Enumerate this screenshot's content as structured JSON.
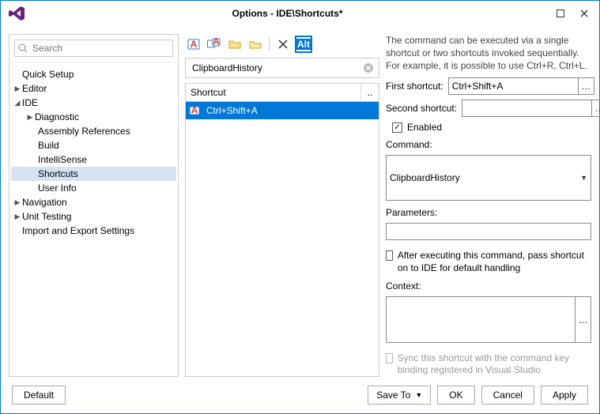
{
  "window": {
    "title": "Options - IDE\\Shortcuts*"
  },
  "search": {
    "placeholder": "Search"
  },
  "tree": {
    "quick_setup": "Quick Setup",
    "editor": "Editor",
    "ide": "IDE",
    "diagnostic": "Diagnostic",
    "assembly_refs": "Assembly References",
    "build": "Build",
    "intellisense": "IntelliSense",
    "shortcuts": "Shortcuts",
    "user_info": "User Info",
    "navigation": "Navigation",
    "unit_testing": "Unit Testing",
    "import_export": "Import and Export Settings"
  },
  "filter": {
    "value": "ClipboardHistory"
  },
  "shortcut_list": {
    "header": "Shortcut",
    "row0": "Ctrl+Shift+A"
  },
  "right": {
    "description": "The command can be executed via a single shortcut or two shortcuts invoked sequentially. For example, it is possible to use Ctrl+R, Ctrl+L.",
    "first_shortcut_label": "First shortcut:",
    "first_shortcut_value": "Ctrl+Shift+A",
    "second_shortcut_label": "Second shortcut:",
    "second_shortcut_value": "",
    "enabled_label": "Enabled",
    "command_label": "Command:",
    "command_value": "ClipboardHistory",
    "parameters_label": "Parameters:",
    "parameters_value": "",
    "pass_on_label": "After executing this command, pass shortcut on to IDE for default handling",
    "context_label": "Context:",
    "context_value": "",
    "sync_label": "Sync this shortcut with the command key binding registered in Visual Studio"
  },
  "footer": {
    "default": "Default",
    "save_to": "Save To",
    "ok": "OK",
    "cancel": "Cancel",
    "apply": "Apply"
  }
}
